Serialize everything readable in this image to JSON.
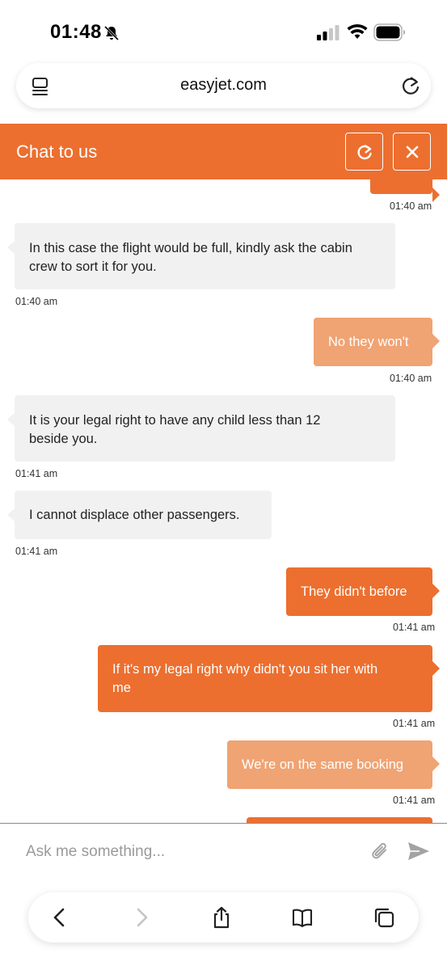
{
  "status_bar": {
    "time": "01:48"
  },
  "browser": {
    "url": "easyjet.com"
  },
  "chat": {
    "title": "Chat to us",
    "messages": [
      {
        "sender": "bot",
        "lines": [
          "In this case the flight would be full, kindly ask the cabin",
          "crew to sort it for you."
        ],
        "time": "01:40 am"
      },
      {
        "sender": "user",
        "lines": [
          "No they won't"
        ],
        "time": "01:40 am"
      },
      {
        "sender": "bot",
        "lines": [
          "It is your legal right to have any child less than 12",
          "beside you."
        ],
        "time": "01:41 am"
      },
      {
        "sender": "bot",
        "lines": [
          "I cannot displace other passengers."
        ],
        "time": "01:41 am"
      },
      {
        "sender": "user",
        "lines": [
          "They didn't before"
        ],
        "time": "01:41 am"
      },
      {
        "sender": "user",
        "lines": [
          "If it's my legal right why didn't you sit her with",
          "me"
        ],
        "time": "01:41 am"
      },
      {
        "sender": "user",
        "lines": [
          "We're on the same booking"
        ],
        "time": "01:41 am"
      }
    ],
    "partial_top_time": "01:40 am",
    "input_placeholder": "Ask me something..."
  },
  "colors": {
    "brand_orange": "#ec6f2f",
    "light_orange": "#f0a373",
    "bot_bubble": "#f1f1f1"
  },
  "icons": [
    "bell-off-icon",
    "signal-icon",
    "wifi-icon",
    "battery-icon",
    "tabs-icon",
    "reload-icon",
    "refresh-icon",
    "close-icon",
    "attach-icon",
    "send-icon",
    "back-icon",
    "forward-icon",
    "share-icon",
    "bookmarks-icon",
    "tabs-overview-icon"
  ]
}
